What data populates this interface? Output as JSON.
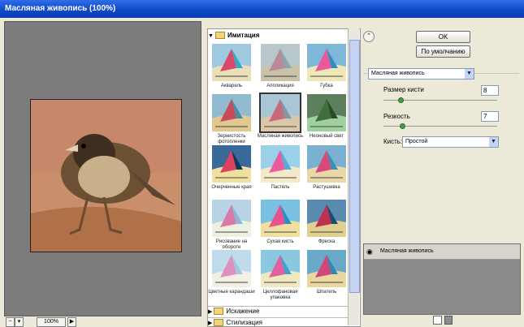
{
  "window": {
    "title": "Масляная живопись (100%)"
  },
  "preview": {
    "zoom": "100%",
    "minus": "−",
    "plus": "+"
  },
  "gallery": {
    "category_open": "Имитация",
    "filters": [
      "Акварель",
      "Аппликация",
      "Губка",
      "Зернистость фотопленки",
      "Масляная живопись",
      "Неоновый свет",
      "Очерченные края",
      "Пастель",
      "Растушевка",
      "Рисование на обороте",
      "Сухая кисть",
      "Фреска",
      "Цветные карандаши",
      "Целлофановая упаковка",
      "Шпатель"
    ],
    "selected_index": 4,
    "categories_closed": [
      "Искажение",
      "Стилизация"
    ]
  },
  "controls": {
    "ok": "OK",
    "default": "По умолчанию",
    "filter_select": "Масляная живопись",
    "brush_size_label": "Размер кисти",
    "brush_size_value": "8",
    "sharpness_label": "Резкость",
    "sharpness_value": "7",
    "brush_label": "Кисть:",
    "brush_value": "Простой"
  },
  "layers": {
    "item": "Масляная живопись"
  },
  "icons": {
    "collapse": "double-chevron-up-icon",
    "eye": "eye-icon",
    "new": "new-layer-icon",
    "trash": "trash-icon"
  }
}
